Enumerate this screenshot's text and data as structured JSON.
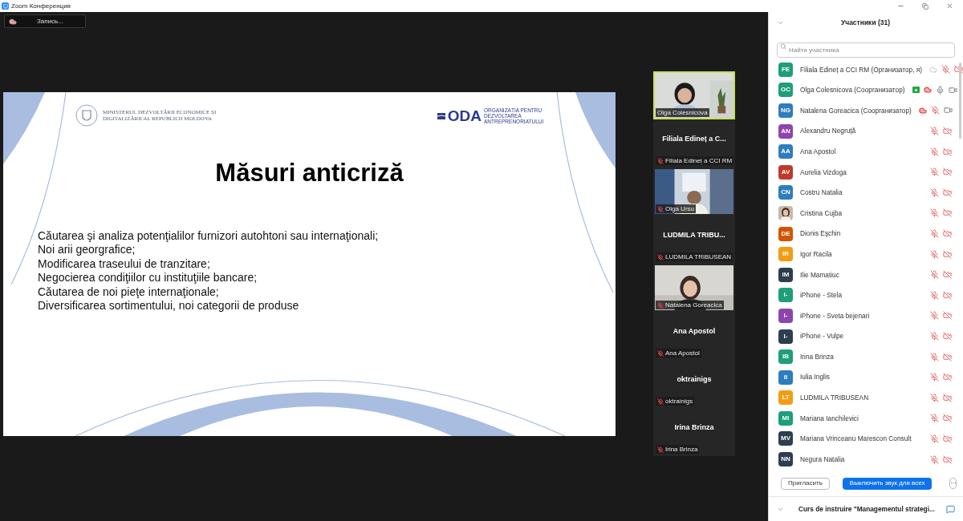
{
  "window": {
    "title": "Zoom Конференция"
  },
  "record_button": {
    "label": "Запись..."
  },
  "slide": {
    "ministry": "MINISTERUL DEZVOLTĂRII ECONOMICE ȘI DIGITALIZĂRII AL REPUBLICII MOLDOVA",
    "oda_logo": "ODA",
    "oda_caption": "ORGANIZAȚIA PENTRU DEZVOLTAREA ANTREPRENORIATULUI",
    "title": "Măsuri anticriză",
    "lines": [
      "Căutarea şi analiza potenţialilor furnizori autohtoni sau internaţionali;",
      "Noi arii georgrafice;",
      "Modificarea traseului de tranzitare;",
      "Negocierea condiţiilor cu instituţiile bancare;",
      "Căutarea de noi pieţe internaţionale;",
      "Diversificarea sortimentului, noi categorii de produse"
    ]
  },
  "video_tiles": [
    {
      "kind": "video",
      "label": "Olga Colesnicova",
      "speaking": true,
      "muted": false
    },
    {
      "kind": "name",
      "title": "Filiala Edineț a C...",
      "label": "Filiala Edineț a CCI RM",
      "speaking": false,
      "muted": true
    },
    {
      "kind": "video",
      "label": "Olga Ursu",
      "speaking": false,
      "muted": true
    },
    {
      "kind": "name",
      "title": "LUDMILA TRIBU...",
      "label": "LUDMILA TRIBUSEAN",
      "speaking": false,
      "muted": true
    },
    {
      "kind": "video",
      "label": "Natalena Goreacica",
      "speaking": false,
      "muted": true
    },
    {
      "kind": "name",
      "title": "Ana Apostol",
      "label": "Ana Apostol",
      "speaking": false,
      "muted": true
    },
    {
      "kind": "name",
      "title": "oktrainigs",
      "label": "oktrainigs",
      "speaking": false,
      "muted": true
    },
    {
      "kind": "name",
      "title": "Irina Brinza",
      "label": "Irina Brinza",
      "speaking": false,
      "muted": true
    }
  ],
  "participants_panel": {
    "title": "Участники (31)",
    "search": {
      "placeholder": "Найти участника"
    },
    "participants": [
      {
        "kind": "initials",
        "initials": "FE",
        "color": "#1e9e7a",
        "name": "Filiala Edineț a CCI RM (Организатор, я)",
        "screen_share": false,
        "cloud_recording": true,
        "cloud_active": false,
        "mic_muted": true,
        "video_off": true
      },
      {
        "kind": "initials",
        "initials": "OC",
        "color": "#1e9e7a",
        "name": "Olga Colesnicova (Соорганизатор)",
        "screen_share": true,
        "cloud_recording": true,
        "cloud_active": true,
        "mic_muted": false,
        "video_off": false
      },
      {
        "kind": "initials",
        "initials": "NG",
        "color": "#2d7dbf",
        "name": "Natalena Goreacica (Соорганизатор)",
        "screen_share": false,
        "cloud_recording": true,
        "cloud_active": true,
        "mic_muted": true,
        "video_off": false
      },
      {
        "kind": "initials",
        "initials": "AN",
        "color": "#8e44ad",
        "name": "Alexandru Negruță",
        "screen_share": false,
        "mic_muted": true,
        "video_off": true
      },
      {
        "kind": "initials",
        "initials": "AA",
        "color": "#2d7dbf",
        "name": "Ana Apostol",
        "screen_share": false,
        "mic_muted": true,
        "video_off": true
      },
      {
        "kind": "initials",
        "initials": "AV",
        "color": "#c0392b",
        "name": "Aurelia Vizdoga",
        "screen_share": false,
        "mic_muted": true,
        "video_off": true
      },
      {
        "kind": "initials",
        "initials": "CN",
        "color": "#2d7dbf",
        "name": "Costru Natalia",
        "screen_share": false,
        "mic_muted": true,
        "video_off": true
      },
      {
        "kind": "picture",
        "name": "Cristina Cujba",
        "screen_share": false,
        "mic_muted": true,
        "video_off": true
      },
      {
        "kind": "initials",
        "initials": "DE",
        "color": "#d35400",
        "name": "Dionis Eşchin",
        "screen_share": false,
        "mic_muted": true,
        "video_off": true
      },
      {
        "kind": "initials",
        "initials": "IR",
        "color": "#f39c12",
        "name": "Igor Racila",
        "screen_share": false,
        "mic_muted": true,
        "video_off": true
      },
      {
        "kind": "initials",
        "initials": "IM",
        "color": "#2c3e50",
        "name": "Ilie Mamatiuc",
        "screen_share": false,
        "mic_muted": true,
        "video_off": true
      },
      {
        "kind": "initials",
        "initials": "I-",
        "color": "#1e9e7a",
        "name": "iPhone - Stela",
        "screen_share": false,
        "mic_muted": true,
        "video_off": true
      },
      {
        "kind": "initials",
        "initials": "I-",
        "color": "#8e44ad",
        "name": "iPhone - Sveta bejenari",
        "screen_share": false,
        "mic_muted": true,
        "video_off": true
      },
      {
        "kind": "initials",
        "initials": "I-",
        "color": "#2c3e50",
        "name": "iPhone - Vulpe",
        "screen_share": false,
        "mic_muted": true,
        "video_off": true
      },
      {
        "kind": "initials",
        "initials": "IB",
        "color": "#1e9e7a",
        "name": "Irina Brinza",
        "screen_share": false,
        "mic_muted": true,
        "video_off": true
      },
      {
        "kind": "initials",
        "initials": "II",
        "color": "#2d7dbf",
        "name": "Iulia Inglis",
        "screen_share": false,
        "mic_muted": true,
        "video_off": true
      },
      {
        "kind": "initials",
        "initials": "LT",
        "color": "#f39c12",
        "name": "LUDMILA TRIBUSEAN",
        "screen_share": false,
        "mic_muted": true,
        "video_off": true
      },
      {
        "kind": "initials",
        "initials": "MI",
        "color": "#1e9e7a",
        "name": "Mariana Ianchilevici",
        "screen_share": false,
        "mic_muted": true,
        "video_off": true
      },
      {
        "kind": "initials",
        "initials": "MV",
        "color": "#2c3e50",
        "name": "Mariana Vrinceanu Marescon Consult",
        "screen_share": false,
        "mic_muted": true,
        "video_off": true
      },
      {
        "kind": "initials",
        "initials": "NN",
        "color": "#2c3e50",
        "name": "Negura Natalia",
        "screen_share": false,
        "mic_muted": true,
        "video_off": true
      }
    ],
    "buttons": [
      {
        "kind": "outline",
        "label": "Пригласить"
      },
      {
        "kind": "primary",
        "label": "Выключить звук для всех"
      },
      {
        "kind": "more",
        "label": "···"
      }
    ]
  },
  "chat_bar": {
    "title": "Curs de instruire \"Managementul strategi..."
  }
}
